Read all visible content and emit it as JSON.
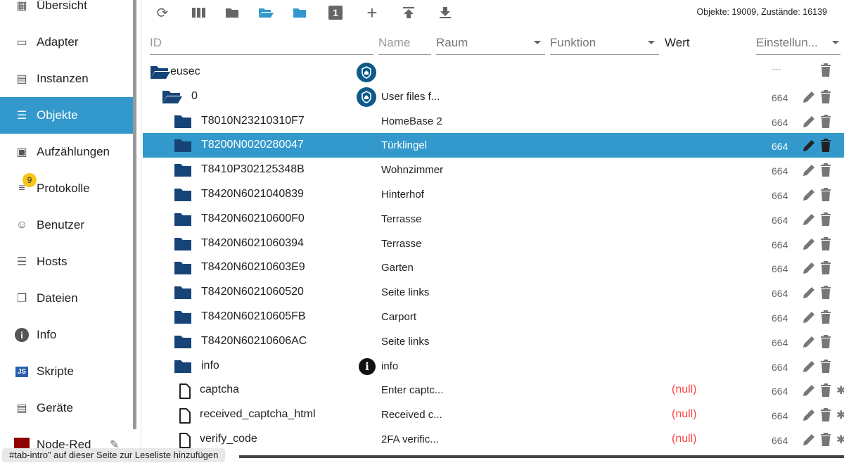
{
  "sidebar": {
    "items": [
      {
        "label": "Übersicht",
        "icon": "grid-icon"
      },
      {
        "label": "Adapter",
        "icon": "store-icon"
      },
      {
        "label": "Instanzen",
        "icon": "instances-icon"
      },
      {
        "label": "Objekte",
        "icon": "list-icon",
        "active": true
      },
      {
        "label": "Aufzählungen",
        "icon": "enum-icon"
      },
      {
        "label": "Protokolle",
        "icon": "log-icon",
        "badge": "9"
      },
      {
        "label": "Benutzer",
        "icon": "user-icon"
      },
      {
        "label": "Hosts",
        "icon": "hosts-icon"
      },
      {
        "label": "Dateien",
        "icon": "files-icon"
      },
      {
        "label": "Info",
        "icon": "info-icon"
      },
      {
        "label": "Skripte",
        "icon": "js-icon"
      },
      {
        "label": "Geräte",
        "icon": "devices-icon"
      },
      {
        "label": "Node-Red",
        "icon": "node-red-icon"
      }
    ]
  },
  "toolbar": {
    "counts": "Objekte: 19009, Zustände: 16139",
    "one_label": "1"
  },
  "columns": {
    "id": "ID",
    "name": "Name",
    "room": "Raum",
    "function": "Funktion",
    "value": "Wert",
    "settings": "Einstellun..."
  },
  "rows": [
    {
      "id": "eusec",
      "name": "",
      "icon": "folder-open",
      "indent": 0,
      "perm": "---",
      "shield": true
    },
    {
      "id": "0",
      "name": "User files f...",
      "icon": "folder-open",
      "indent": 1,
      "perm": "664",
      "shield": true
    },
    {
      "id": "T8010N23210310F7",
      "name": "HomeBase 2",
      "icon": "folder",
      "indent": 2,
      "perm": "664"
    },
    {
      "id": "T8200N0020280047",
      "name": "Türklingel",
      "icon": "folder",
      "indent": 2,
      "perm": "664",
      "selected": true
    },
    {
      "id": "T8410P302125348B",
      "name": "Wohnzimmer",
      "icon": "folder",
      "indent": 2,
      "perm": "664"
    },
    {
      "id": "T8420N6021040839",
      "name": "Hinterhof",
      "icon": "folder",
      "indent": 2,
      "perm": "664"
    },
    {
      "id": "T8420N60210600F0",
      "name": "Terrasse",
      "icon": "folder",
      "indent": 2,
      "perm": "664"
    },
    {
      "id": "T8420N6021060394",
      "name": "Terrasse",
      "icon": "folder",
      "indent": 2,
      "perm": "664"
    },
    {
      "id": "T8420N60210603E9",
      "name": "Garten",
      "icon": "folder",
      "indent": 2,
      "perm": "664"
    },
    {
      "id": "T8420N6021060520",
      "name": "Seite links",
      "icon": "folder",
      "indent": 2,
      "perm": "664"
    },
    {
      "id": "T8420N60210605FB",
      "name": "Carport",
      "icon": "folder",
      "indent": 2,
      "perm": "664"
    },
    {
      "id": "T8420N60210606AC",
      "name": "Seite links",
      "icon": "folder",
      "indent": 2,
      "perm": "664"
    },
    {
      "id": "info",
      "name": "info",
      "icon": "folder",
      "indent": 2,
      "perm": "664",
      "info": true
    },
    {
      "id": "captcha",
      "name": "Enter captc...",
      "icon": "file",
      "indent": 2,
      "perm": "664",
      "value": "(null)"
    },
    {
      "id": "received_captcha_html",
      "name": "Received c...",
      "icon": "file",
      "indent": 2,
      "perm": "664",
      "value": "(null)"
    },
    {
      "id": "verify_code",
      "name": "2FA verific...",
      "icon": "file",
      "indent": 2,
      "perm": "664",
      "value": "(null)"
    }
  ],
  "tooltip": "#tab-intro\" auf dieser Seite zur Leseliste hinzufügen",
  "colors": {
    "accent": "#3399cc",
    "folder": "#164477",
    "null": "#f44444"
  }
}
